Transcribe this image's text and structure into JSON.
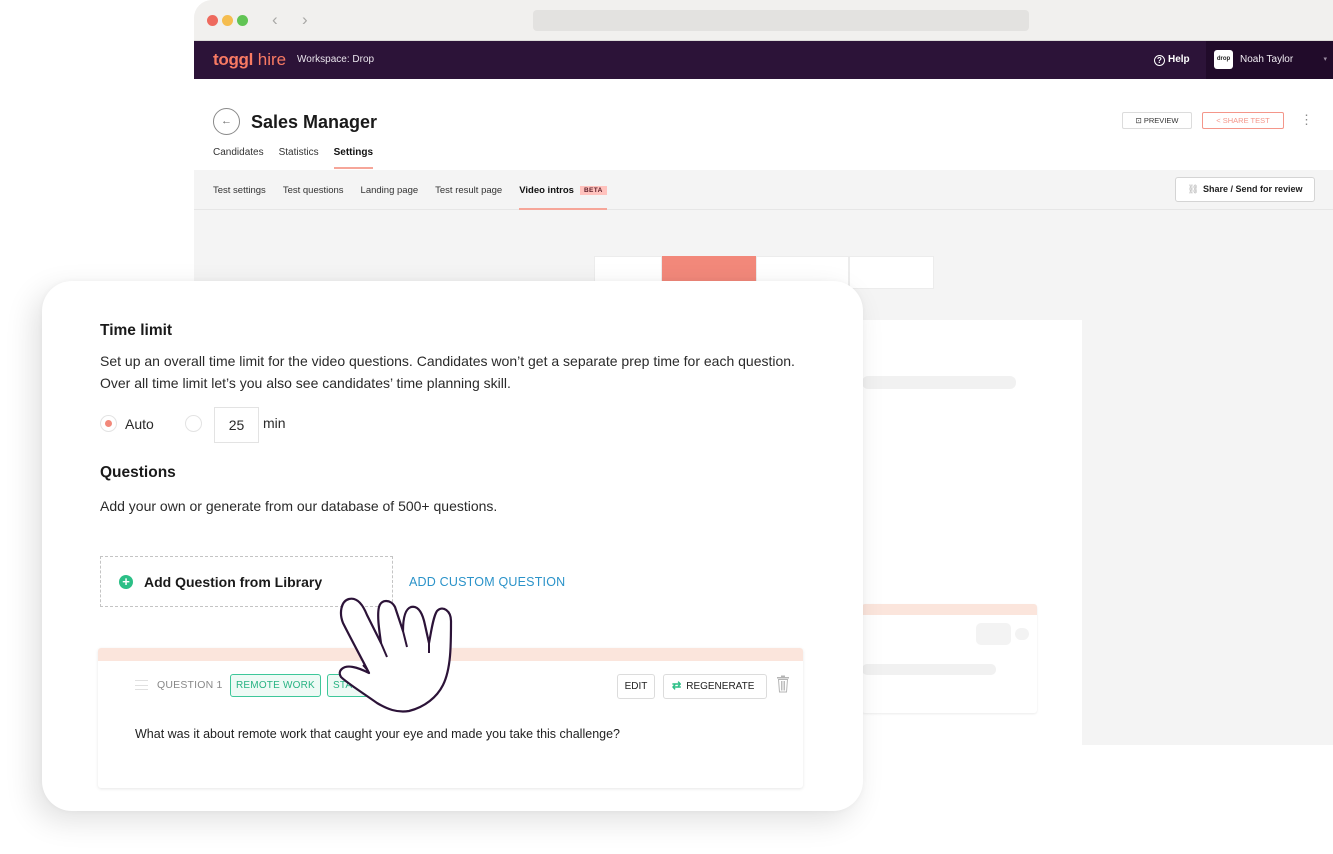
{
  "browser": {
    "nav_back": "‹",
    "nav_forward": "›"
  },
  "topbar": {
    "logo_bold": "toggl",
    "logo_light": "hire",
    "workspace": "Workspace: Drop",
    "help_label": "Help",
    "help_icon": "?",
    "user_avatar_text": "drop",
    "user_name": "Noah Taylor",
    "user_caret": "▾"
  },
  "header": {
    "back_icon": "←",
    "title": "Sales Manager",
    "preview_label": "PREVIEW",
    "share_test_label": "SHARE TEST",
    "more_icon": "⋮",
    "tabs": [
      {
        "label": "Candidates",
        "active": false
      },
      {
        "label": "Statistics",
        "active": false
      },
      {
        "label": "Settings",
        "active": true
      }
    ]
  },
  "subtabs": {
    "items": [
      {
        "label": "Test settings",
        "active": false
      },
      {
        "label": "Test questions",
        "active": false
      },
      {
        "label": "Landing page",
        "active": false
      },
      {
        "label": "Test result page",
        "active": false
      },
      {
        "label": "Video intros",
        "active": true,
        "badge": "BETA"
      }
    ],
    "share_review_label": "Share / Send for review",
    "share_review_icon": "🔗"
  },
  "overlay": {
    "time_limit": {
      "title": "Time limit",
      "description": "Set up an overall time limit for the video questions. Candidates won’t get a separate prep time for each question. Over all time limit let’s you also see candidates’ time planning skill.",
      "options": [
        {
          "label": "Auto",
          "checked": true
        },
        {
          "label": "",
          "checked": false
        }
      ],
      "minutes_value": "25",
      "minutes_unit": "min"
    },
    "questions": {
      "title": "Questions",
      "description": "Add your own or generate from our database of 500+ questions.",
      "add_library_label": "Add Question from Library",
      "add_library_icon": "+",
      "add_custom_label": "ADD CUSTOM QUESTION"
    },
    "question_card": {
      "label": "QUESTION 1",
      "tags": [
        "REMOTE WORK",
        "STANDARD"
      ],
      "edit_label": "EDIT",
      "regenerate_label": "REGENERATE",
      "regenerate_icon": "⇄",
      "text": "What was it about remote work that caught your eye and made you take this challenge?"
    }
  },
  "colors": {
    "brand_dark": "#2c1338",
    "accent_coral": "#f2887a",
    "accent_green": "#2bbf86",
    "link_blue": "#2b93c9"
  }
}
